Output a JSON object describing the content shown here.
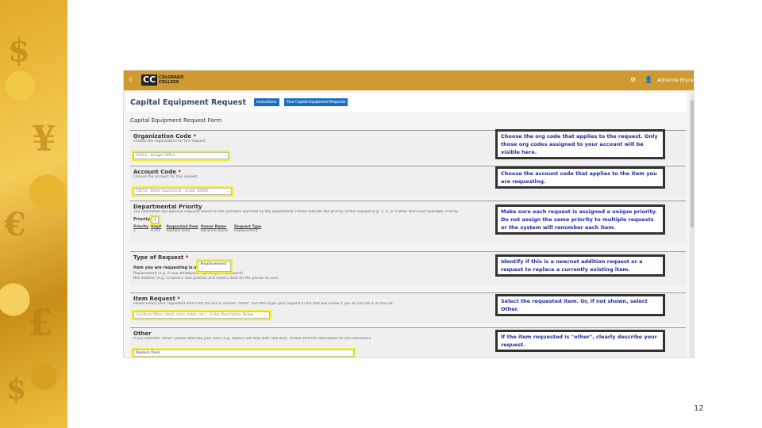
{
  "topbar": {
    "logo_abbr": "CC",
    "logo_line1": "COLORADO",
    "logo_line2": "COLLEGE",
    "user": "Adrienne Bryce"
  },
  "header": {
    "title": "Capital Equipment Request",
    "buttons": [
      "Instructions",
      "Your Capital Equipment Requests"
    ]
  },
  "form_title": "Capital Equipment Request Form",
  "sections": {
    "org": {
      "title": "Organization Code",
      "required": "*",
      "help": "Choose the organization for this request.",
      "value": "10001 - Budget Office"
    },
    "account": {
      "title": "Account Code",
      "required": "*",
      "help": "Choose the account for this request.",
      "value": "74552 - Other Equipment - Under $5000 ..."
    },
    "priority": {
      "title": "Departmental Priority",
      "help": "The committee will approve requests based on the priorities specified by the department. Please indicate the priority of this request (e.g. 1, 2, 3) if other than next available. Priority",
      "label": "Priority",
      "value": "1",
      "table_headers": [
        "Priority",
        "Req#",
        "Requested Item",
        "Owner Name",
        "Request Type"
      ],
      "table_row": [
        "1",
        "4703",
        "Replace Desk",
        "Adrienne Bryce",
        "Replacement"
      ]
    },
    "type": {
      "title": "Type of Request",
      "required": "*",
      "label": "Item you are requesting is a",
      "value": "Replacement",
      "help1": "Replacement (e.g. A new whiteboard replacing a chalkboard)",
      "help2": "Net Addition (e.g. Created a new position and need a desk for the person to use)"
    },
    "item": {
      "title": "Item Request",
      "required": "*",
      "help": "Please select your requested item from the list or choose \"Other\" and then type your request in the text box below if you do not see it on the list.",
      "value": "Furniture Other (desk, chair, table, etc.) - Enter Description Below"
    },
    "other": {
      "title": "Other",
      "help": "If you selected \"other\" please describe your item (e.g. replace old desk with new one). Please limit the description to 100 characters.",
      "value": "Replace Desk"
    }
  },
  "notes": [
    "Choose the org code that applies to the request. Only those org codes assigned to your account will be visible here.",
    "Choose the account code that applies to the item you are requesting.",
    "Make sure each request is assigned a unique priority. Do not assign the same priority to multiple requests or the system will renumber each item.",
    "Identify if this is a new/net addition request or a request to replace a currently existing item.",
    "Select the requested item. Or, if not shown, select Other.",
    "If the item requested is \"other\", clearly describe your request."
  ],
  "page_number": "12"
}
